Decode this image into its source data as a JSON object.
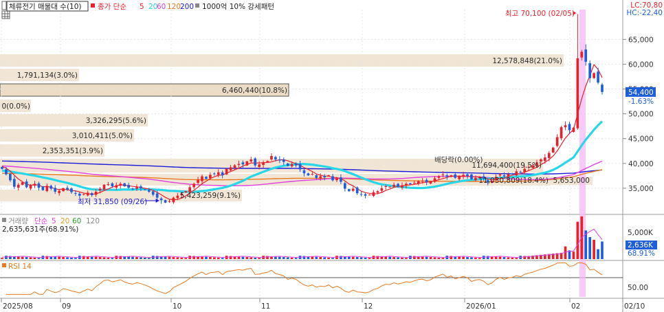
{
  "header": {
    "indicator_label": "체류전기 매물대 수(10)",
    "ma_label": "종가 단순",
    "ma_periods": [
      "5",
      "20",
      "60",
      "120",
      "200"
    ],
    "ma_colors": [
      "#e8202a",
      "#27d7e8",
      "#e040e0",
      "#e87a20",
      "#1a1ad6"
    ],
    "pattern_label": "1000억 10% 강세패턴",
    "lc": "LC:70,80",
    "hc": "HC:-22,40"
  },
  "price_axis": {
    "ticks": [
      "65,000",
      "60,000",
      "55,000",
      "50,000",
      "45,000",
      "40,000",
      "35,000"
    ],
    "current_price": "54,400",
    "current_change": "-1.63%"
  },
  "volume_axis": {
    "tick": "5,000K",
    "current": "2,636K",
    "current_pct": "68.91%"
  },
  "rsi_axis": {
    "tick": "50.00"
  },
  "date_labels": [
    "2025/08",
    "09",
    "10",
    "11",
    "12",
    "2026/01",
    "02",
    "02/10"
  ],
  "annotations": {
    "high": "최고 70,100 (02/05)",
    "low": "최저 31,850 (09/26)",
    "dividend": "배당락(0.00%)"
  },
  "volume_profile": [
    {
      "label": "12,578,848(21.0%)",
      "box": "#f1e6d6"
    },
    {
      "label": "1,791,134(3.0%)",
      "box": "#f1e6d6"
    },
    {
      "label": "6,460,440(10.8%)",
      "box": "#ecdcc6"
    },
    {
      "label": "0(0.0%)",
      "box": "#f1e6d6"
    },
    {
      "label": "3,326,295(5.6%)",
      "box": "#f1e6d6"
    },
    {
      "label": "3,010,411(5.0%)",
      "box": "#f1e6d6"
    },
    {
      "label": "2,353,351(3.9%)",
      "box": "#f1e6d6"
    },
    {
      "label": "11,694,400(19.5%)",
      "box": "#f1e6d6"
    },
    {
      "label": "5,423,259(9.1%)",
      "box": "#f1e6d6"
    },
    {
      "label": "11,030,809(18.4%)",
      "box": "#f1e6d6"
    },
    {
      "label": "5,653,000",
      "box": "#f1e6d6"
    }
  ],
  "volume_panel": {
    "label": "거래량",
    "ma_label": "단순",
    "ma_periods": [
      "5",
      "20",
      "60",
      "120"
    ],
    "current_text": "2,635,631주(68.91%)"
  },
  "rsi_panel": {
    "label": "RSI 14"
  },
  "chart_data": {
    "type": "candlestick",
    "x_axis_labels": [
      "2025/08",
      "09",
      "10",
      "11",
      "12",
      "2026/01",
      "02",
      "02/10"
    ],
    "ylim": [
      30000,
      71000
    ],
    "close": [
      38900,
      37800,
      36600,
      35300,
      35700,
      36200,
      35200,
      35600,
      35900,
      35100,
      34600,
      35500,
      34900,
      34300,
      34500,
      35000,
      34700,
      34200,
      33900,
      33500,
      33800,
      34100,
      33600,
      34300,
      34900,
      35700,
      35800,
      35400,
      35600,
      35900,
      35400,
      35100,
      34900,
      35200,
      35000,
      34700,
      34300,
      33700,
      33100,
      32600,
      32100,
      32400,
      33100,
      33500,
      33900,
      34400,
      35200,
      35900,
      36700,
      37400,
      36900,
      37700,
      37900,
      38200,
      37600,
      38900,
      39200,
      39600,
      39900,
      39800,
      40400,
      40800,
      39600,
      39800,
      40200,
      40500,
      41500,
      40800,
      40600,
      40300,
      39500,
      39900,
      39600,
      38800,
      38000,
      37600,
      37900,
      37100,
      37400,
      37200,
      37600,
      36600,
      37000,
      36300,
      34900,
      34400,
      34900,
      34000,
      33800,
      33500,
      33700,
      34200,
      34400,
      35000,
      35400,
      35300,
      35700,
      35400,
      35600,
      35900,
      35800,
      36100,
      36400,
      36500,
      36200,
      36400,
      37000,
      37400,
      37800,
      37300,
      37600,
      37100,
      37400,
      37700,
      37500,
      36800,
      37100,
      37200,
      36900,
      36200,
      36500,
      37300,
      37800,
      37400,
      37800,
      37900,
      38400,
      38200,
      38900,
      39300,
      39600,
      40200,
      40800,
      41200,
      42100,
      43200,
      45300,
      47300,
      47700,
      46700,
      47200,
      61200,
      62500,
      60500,
      57200,
      58200,
      56300,
      54400
    ],
    "ohlc_note": "daily candles, close values above; red = up, blue = down",
    "series": [
      {
        "name": "5",
        "values": []
      },
      {
        "name": "20",
        "values": []
      },
      {
        "name": "60",
        "values": []
      },
      {
        "name": "120",
        "values": []
      },
      {
        "name": "200",
        "values": []
      }
    ]
  }
}
